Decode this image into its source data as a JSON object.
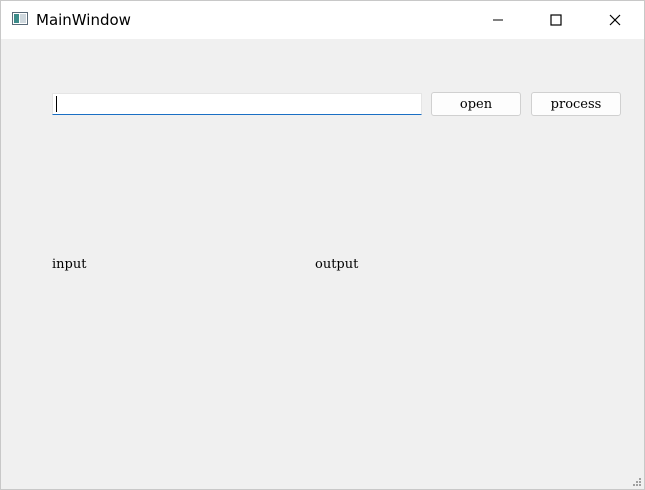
{
  "window": {
    "title": "MainWindow",
    "icon": "app-window-icon"
  },
  "titlebar_buttons": {
    "minimize_icon": "minimize-icon",
    "maximize_icon": "maximize-icon",
    "close_icon": "close-icon"
  },
  "toolbar": {
    "path_input_value": "",
    "path_input_placeholder": "",
    "open_label": "open",
    "process_label": "process"
  },
  "labels": {
    "input": "input",
    "output": "output"
  },
  "colors": {
    "input_focus_underline": "#1a6fc4",
    "window_background": "#f0f0f0",
    "titlebar_background": "#ffffff"
  }
}
